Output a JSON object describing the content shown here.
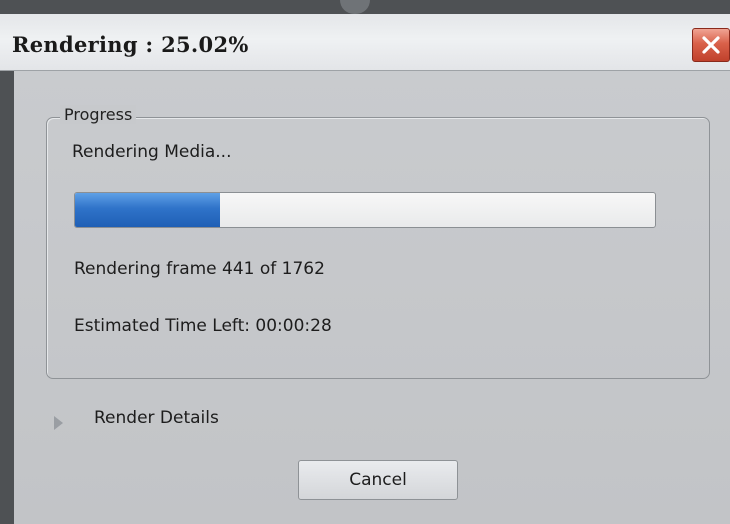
{
  "window": {
    "title": "Rendering : 25.02%",
    "close_icon": "close-icon"
  },
  "progress_group": {
    "legend": "Progress",
    "status": "Rendering Media...",
    "progress_fraction": 0.25,
    "frame_text": "Rendering frame 441 of 1762",
    "time_left_text": "Estimated Time Left: 00:00:28"
  },
  "details": {
    "label": "Render Details",
    "expander_icon": "triangle-right-icon"
  },
  "buttons": {
    "cancel_label": "Cancel"
  },
  "colors": {
    "progress_fill": "#2f73c9",
    "close_button": "#d9614a"
  }
}
